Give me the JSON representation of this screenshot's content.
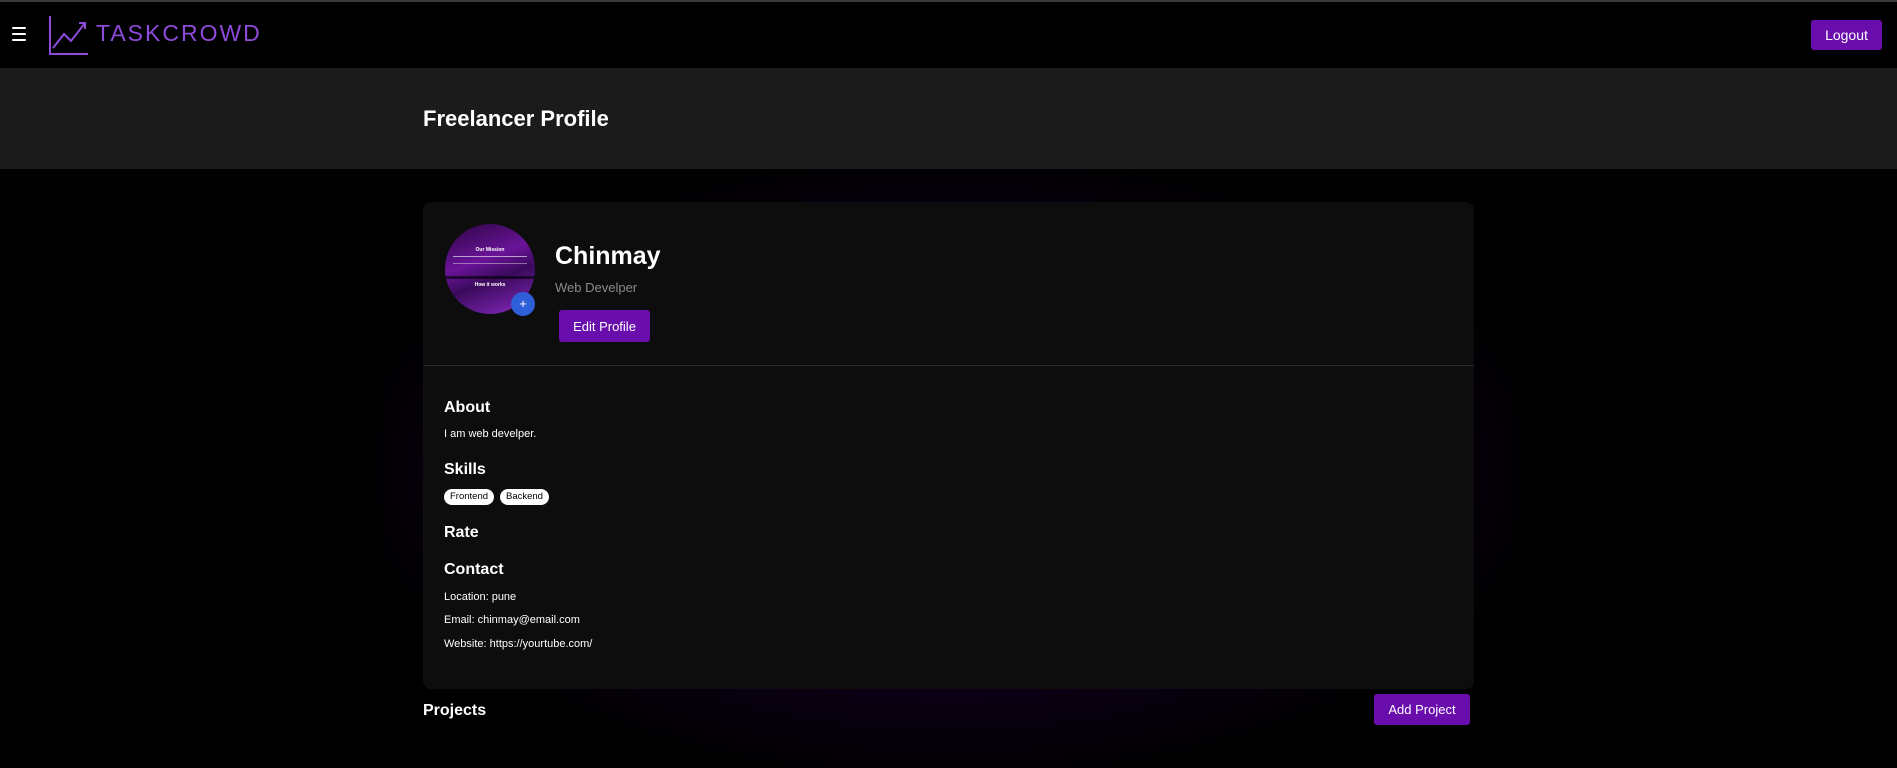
{
  "navbar": {
    "menu_icon": "hamburger-menu-icon",
    "logo_icon": "trending-chart-icon",
    "brand": "TASKCROWD",
    "logout_label": "Logout"
  },
  "page": {
    "title": "Freelancer Profile"
  },
  "profile": {
    "avatar_heading_1": "Our Mission",
    "avatar_heading_2": "How it works",
    "avatar_add_icon": "plus-icon",
    "name": "Chinmay",
    "title": "Web Develper",
    "edit_label": "Edit Profile"
  },
  "about": {
    "heading": "About",
    "text": "I am web develper."
  },
  "skills": {
    "heading": "Skills",
    "items": [
      "Frontend",
      "Backend"
    ]
  },
  "rate": {
    "heading": "Rate"
  },
  "contact": {
    "heading": "Contact",
    "location": "Location: pune",
    "email": "Email: chinmay@email.com",
    "website": "Website: https://yourtube.com/"
  },
  "projects": {
    "heading": "Projects",
    "add_label": "Add Project"
  },
  "colors": {
    "accent": "#6a0dad",
    "brand": "#8e4ad8",
    "badge_blue": "#2f5fd8",
    "banner": "#1b1b1b",
    "card": "#0d0d0d"
  }
}
